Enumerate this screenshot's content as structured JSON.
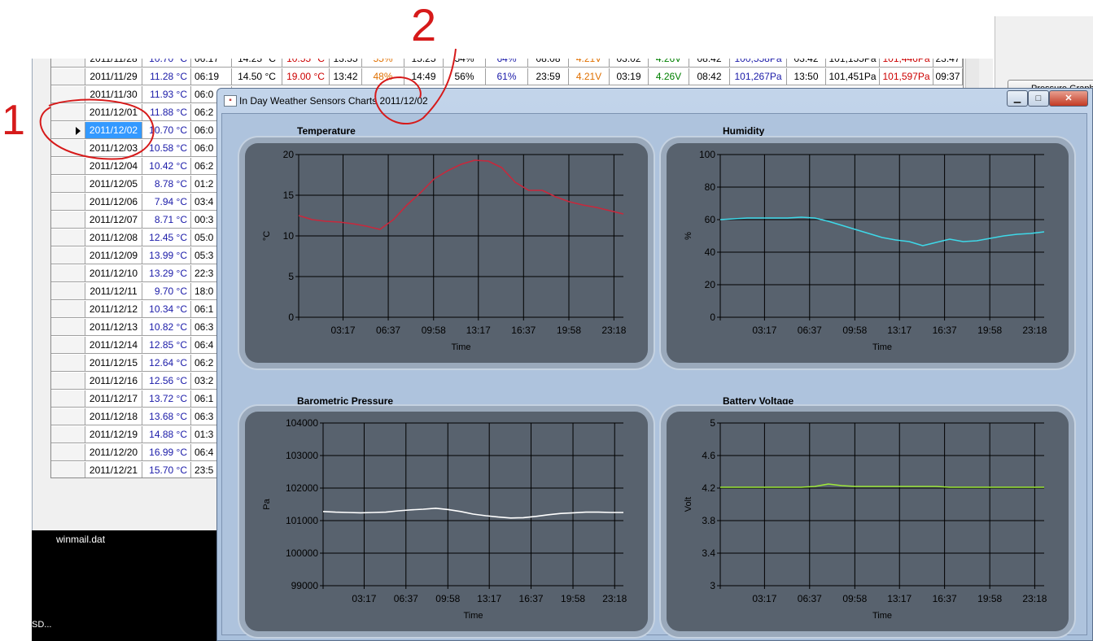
{
  "background_app": {
    "rows": [
      {
        "date": "2011/11/28",
        "temp": "10.70 °C",
        "time": "06:17",
        "c4": "14.25 °C",
        "c5": "10.55 °C",
        "c6": "13:55",
        "c7": "55%",
        "c8": "15:25",
        "c9": "54%",
        "c10": "64%",
        "c11": "08:08",
        "c12": "4.21V",
        "c13": "03:02",
        "c14": "4.26V",
        "c15": "08:42",
        "c16": "100,558Pa",
        "c17": "03:42",
        "c18": "101,155Pa",
        "c19": "101,446Pa",
        "c20": "23:47"
      },
      {
        "date": "2011/11/29",
        "temp": "11.28 °C",
        "time": "06:19",
        "c4": "14.50 °C",
        "c5": "19.00 °C",
        "c6": "13:42",
        "c7": "48%",
        "c8": "14:49",
        "c9": "56%",
        "c10": "61%",
        "c11": "23:59",
        "c12": "4.21V",
        "c13": "03:19",
        "c14": "4.26V",
        "c15": "08:42",
        "c16": "101,267Pa",
        "c17": "13:50",
        "c18": "101,451Pa",
        "c19": "101,597Pa",
        "c20": "09:37"
      },
      {
        "date": "2011/11/30",
        "temp": "11.93 °C",
        "time": "06:0"
      },
      {
        "date": "2011/12/01",
        "temp": "11.88 °C",
        "time": "06:2"
      },
      {
        "date": "2011/12/02",
        "temp": "10.70 °C",
        "time": "06:0"
      },
      {
        "date": "2011/12/03",
        "temp": "10.58 °C",
        "time": "06:0"
      },
      {
        "date": "2011/12/04",
        "temp": "10.42 °C",
        "time": "06:2"
      },
      {
        "date": "2011/12/05",
        "temp": "8.78 °C",
        "time": "01:2"
      },
      {
        "date": "2011/12/06",
        "temp": "7.94 °C",
        "time": "03:4"
      },
      {
        "date": "2011/12/07",
        "temp": "8.71 °C",
        "time": "00:3"
      },
      {
        "date": "2011/12/08",
        "temp": "12.45 °C",
        "time": "05:0"
      },
      {
        "date": "2011/12/09",
        "temp": "13.99 °C",
        "time": "05:3"
      },
      {
        "date": "2011/12/10",
        "temp": "13.29 °C",
        "time": "22:3"
      },
      {
        "date": "2011/12/11",
        "temp": "9.70 °C",
        "time": "18:0"
      },
      {
        "date": "2011/12/12",
        "temp": "10.34 °C",
        "time": "06:1"
      },
      {
        "date": "2011/12/13",
        "temp": "10.82 °C",
        "time": "06:3"
      },
      {
        "date": "2011/12/14",
        "temp": "12.85 °C",
        "time": "06:4"
      },
      {
        "date": "2011/12/15",
        "temp": "12.64 °C",
        "time": "06:2"
      },
      {
        "date": "2011/12/16",
        "temp": "12.56 °C",
        "time": "03:2"
      },
      {
        "date": "2011/12/17",
        "temp": "13.72 °C",
        "time": "06:1"
      },
      {
        "date": "2011/12/18",
        "temp": "13.68 °C",
        "time": "06:3"
      },
      {
        "date": "2011/12/19",
        "temp": "14.88 °C",
        "time": "01:3"
      },
      {
        "date": "2011/12/20",
        "temp": "16.99 °C",
        "time": "06:4"
      },
      {
        "date": "2011/12/21",
        "temp": "15.70 °C",
        "time": "23:5"
      }
    ],
    "selected_date": "2011/12/02",
    "pressure_graph_button": "Pressure Graph",
    "taskbar_file": "winmail.dat",
    "taskbar_small": "SD..."
  },
  "dialog": {
    "title": "In Day Weather Sensors Charts 2011/12/02",
    "minimize": "▁",
    "maximize": "□",
    "close": "✕"
  },
  "annotations": {
    "one": "1",
    "two": "2"
  },
  "colors": {
    "temperature": "#c8283c",
    "humidity": "#3ed8e8",
    "pressure": "#ffffff",
    "battery": "#9ee83a",
    "plot_bg": "#58626e"
  },
  "chart_data": [
    {
      "type": "line",
      "title": "Temperature",
      "xlabel": "Time",
      "ylabel": "°C",
      "xticks": [
        "03:17",
        "06:37",
        "09:58",
        "13:17",
        "16:37",
        "19:58",
        "23:18"
      ],
      "yticks": [
        "0",
        "5",
        "10",
        "15",
        "20"
      ],
      "ylim": [
        0,
        20
      ],
      "x_hours": [
        0,
        1,
        2,
        3,
        4,
        5,
        6,
        7,
        8,
        9,
        10,
        11,
        12,
        13,
        14,
        15,
        16,
        17,
        18,
        19,
        20,
        21,
        22,
        23,
        24
      ],
      "series": [
        {
          "values": [
            12.5,
            12,
            11.8,
            11.7,
            11.5,
            11.2,
            10.8,
            12,
            13.8,
            15.3,
            17,
            18,
            18.8,
            19.3,
            19.2,
            18.4,
            16.6,
            15.6,
            15.6,
            14.8,
            14.2,
            13.8,
            13.5,
            13.1,
            12.7
          ]
        }
      ],
      "grid": true
    },
    {
      "type": "line",
      "title": "Humidity",
      "xlabel": "Time",
      "ylabel": "%",
      "xticks": [
        "03:17",
        "06:37",
        "09:58",
        "13:17",
        "16:37",
        "19:58",
        "23:18"
      ],
      "yticks": [
        "0",
        "20",
        "40",
        "60",
        "80",
        "100"
      ],
      "ylim": [
        0,
        100
      ],
      "x_hours": [
        0,
        1,
        2,
        3,
        4,
        5,
        6,
        7,
        8,
        9,
        10,
        11,
        12,
        13,
        14,
        15,
        16,
        17,
        18,
        19,
        20,
        21,
        22,
        23,
        24
      ],
      "series": [
        {
          "values": [
            60,
            60.5,
            61,
            61,
            61,
            61,
            61.5,
            61,
            59,
            56.5,
            54,
            51.5,
            49,
            47.5,
            46.5,
            44,
            46,
            48,
            46.5,
            47,
            48.5,
            50,
            51,
            51.5,
            52.5
          ]
        }
      ],
      "grid": true
    },
    {
      "type": "line",
      "title": "Barometric Pressure",
      "xlabel": "Time",
      "ylabel": "Pa",
      "xticks": [
        "03:17",
        "06:37",
        "09:58",
        "13:17",
        "16:37",
        "19:58",
        "23:18"
      ],
      "yticks": [
        "99000",
        "100000",
        "101000",
        "102000",
        "103000",
        "104000"
      ],
      "ylim": [
        99000,
        104000
      ],
      "x_hours": [
        0,
        1,
        2,
        3,
        4,
        5,
        6,
        7,
        8,
        9,
        10,
        11,
        12,
        13,
        14,
        15,
        16,
        17,
        18,
        19,
        20,
        21,
        22,
        23,
        24
      ],
      "series": [
        {
          "values": [
            101280,
            101260,
            101250,
            101240,
            101250,
            101260,
            101300,
            101330,
            101350,
            101380,
            101340,
            101280,
            101200,
            101150,
            101110,
            101080,
            101090,
            101130,
            101180,
            101220,
            101240,
            101260,
            101260,
            101250,
            101250
          ]
        }
      ],
      "grid": true
    },
    {
      "type": "line",
      "title": "Battery Voltage",
      "xlabel": "Time",
      "ylabel": "Volt",
      "xticks": [
        "03:17",
        "06:37",
        "09:58",
        "13:17",
        "16:37",
        "19:58",
        "23:18"
      ],
      "yticks": [
        "3",
        "3.4",
        "3.8",
        "4.2",
        "4.6",
        "5"
      ],
      "ylim": [
        3,
        5
      ],
      "x_hours": [
        0,
        1,
        2,
        3,
        4,
        5,
        6,
        7,
        8,
        9,
        10,
        11,
        12,
        13,
        14,
        15,
        16,
        17,
        18,
        19,
        20,
        21,
        22,
        23,
        24
      ],
      "series": [
        {
          "values": [
            4.21,
            4.21,
            4.21,
            4.21,
            4.21,
            4.21,
            4.21,
            4.22,
            4.25,
            4.23,
            4.22,
            4.22,
            4.22,
            4.22,
            4.22,
            4.22,
            4.22,
            4.21,
            4.21,
            4.21,
            4.21,
            4.21,
            4.21,
            4.21,
            4.21
          ]
        }
      ],
      "grid": true
    }
  ]
}
